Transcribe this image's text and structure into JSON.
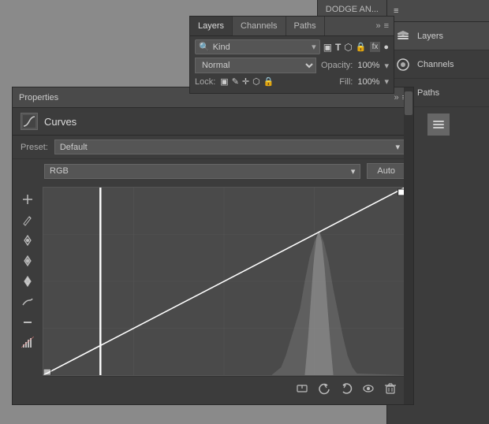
{
  "background": {
    "color": "#8a8a8a"
  },
  "dodge_title": "DODGE AN...",
  "right_panel": {
    "title": "Layers",
    "items": [
      {
        "label": "Layers",
        "icon": "layers-icon",
        "active": true
      },
      {
        "label": "Channels",
        "icon": "channels-icon",
        "active": false
      },
      {
        "label": "Paths",
        "icon": "paths-icon",
        "active": false
      }
    ]
  },
  "layers_panel": {
    "tabs": [
      {
        "label": "Layers",
        "active": true
      },
      {
        "label": "Channels",
        "active": false
      },
      {
        "label": "Paths",
        "active": false
      }
    ],
    "kind_label": "Kind",
    "blend_mode": "Normal",
    "opacity_label": "Opacity:",
    "opacity_value": "100%",
    "lock_label": "Lock:",
    "fill_label": "Fill:",
    "fill_value": "100%"
  },
  "properties_panel": {
    "title": "Properties",
    "section_title": "Curves",
    "preset_label": "Preset:",
    "preset_value": "Default",
    "rgb_value": "RGB",
    "auto_label": "Auto",
    "left_tools": [
      {
        "icon": "↕",
        "name": "region-tool"
      },
      {
        "icon": "✎",
        "name": "pencil-tool"
      },
      {
        "icon": "◎",
        "name": "eyedropper-tool"
      },
      {
        "icon": "⚡",
        "name": "curves-tool"
      },
      {
        "icon": "✒",
        "name": "pen-tool"
      },
      {
        "icon": "⚙",
        "name": "minus-tool"
      },
      {
        "icon": "▲",
        "name": "warning-tool"
      }
    ],
    "bottom_icons": [
      "⊞",
      "↺",
      "↩",
      "◉",
      "🗑"
    ]
  }
}
